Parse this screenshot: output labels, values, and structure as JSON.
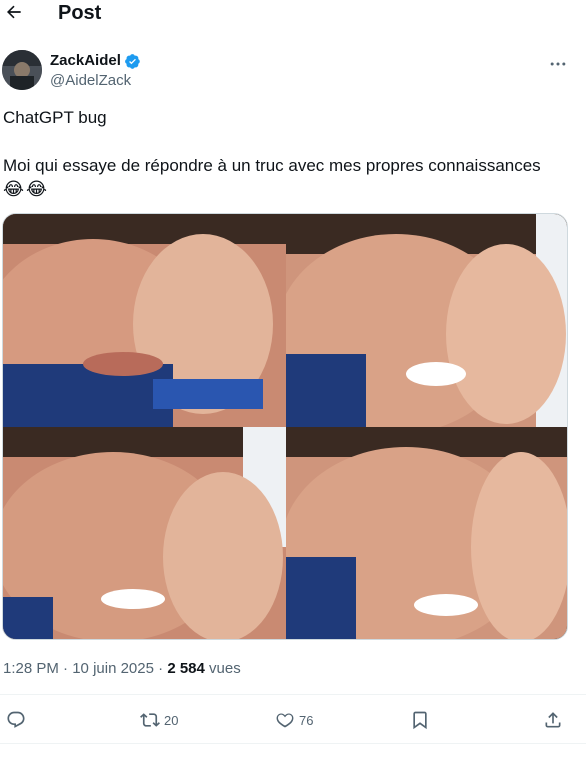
{
  "header": {
    "title": "Post",
    "back_icon": "arrow-left-icon"
  },
  "author": {
    "name": "ZackAidel",
    "handle": "@AidelZack",
    "verified_icon": "verified-badge-icon",
    "verified_color": "#1d9bf0",
    "more_icon": "more-horizontal-icon"
  },
  "post": {
    "line1": "ChatGPT bug",
    "line2": "Moi qui essaye de répondre à un truc avec mes propres connaissances",
    "emojis": [
      "😂",
      "😂"
    ]
  },
  "meta": {
    "time": "1:28 PM",
    "separator": " · ",
    "date": "10 juin 2025",
    "views_count": "2 584",
    "views_label": "vues"
  },
  "actions": {
    "reply": {
      "icon": "reply-icon",
      "count": ""
    },
    "repost": {
      "icon": "repost-icon",
      "count": "20"
    },
    "like": {
      "icon": "heart-icon",
      "count": "76"
    },
    "bookmark": {
      "icon": "bookmark-icon",
      "count": ""
    },
    "share": {
      "icon": "share-icon",
      "count": ""
    }
  },
  "colors": {
    "text": "#0f1419",
    "secondary": "#536471",
    "accent": "#1d9bf0",
    "border": "#eff3f4"
  }
}
